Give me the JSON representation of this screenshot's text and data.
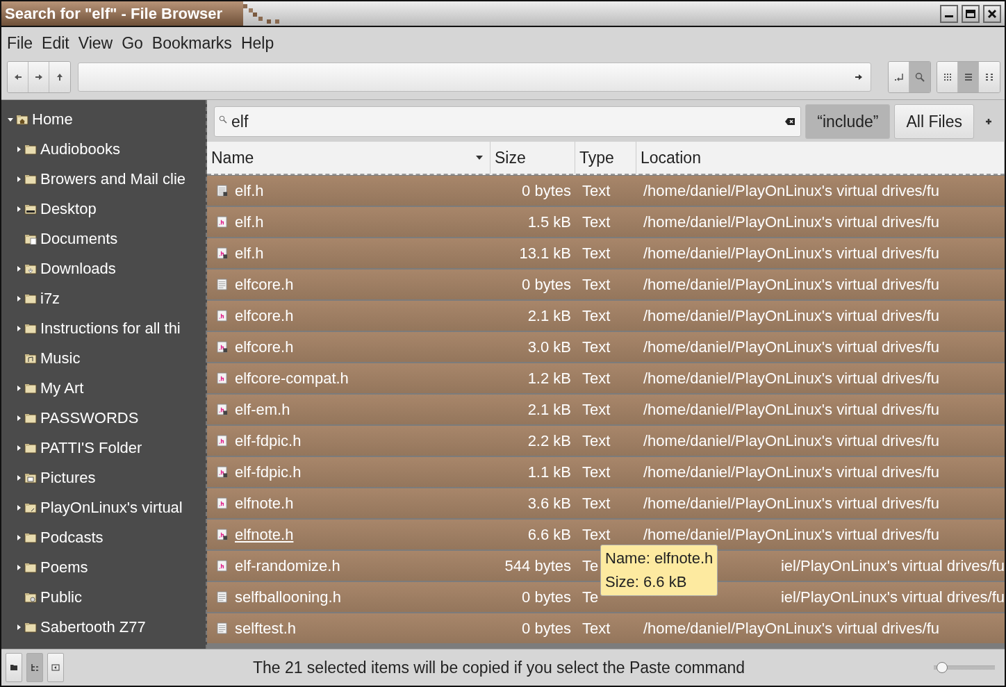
{
  "window": {
    "title": "Search for \"elf\" - File Browser"
  },
  "menu": [
    "File",
    "Edit",
    "View",
    "Go",
    "Bookmarks",
    "Help"
  ],
  "toolbar": {
    "nav": [
      {
        "kind": "back"
      },
      {
        "kind": "forward"
      },
      {
        "kind": "up"
      }
    ],
    "mode_toggles": [
      {
        "kind": "pathbar",
        "selected": false
      },
      {
        "kind": "search",
        "selected": true
      }
    ],
    "view_toggles": [
      {
        "kind": "icons",
        "selected": false
      },
      {
        "kind": "list",
        "selected": true
      },
      {
        "kind": "compact",
        "selected": false
      }
    ]
  },
  "sidebar": {
    "tree": [
      {
        "label": "Home",
        "kind": "home",
        "expandable": true,
        "expanded": true,
        "children": [
          {
            "label": "Audiobooks",
            "kind": "folder",
            "expandable": true,
            "expanded": false
          },
          {
            "label": "Browers and Mail clie",
            "kind": "folder",
            "expandable": true,
            "expanded": false
          },
          {
            "label": "Desktop",
            "kind": "desktop",
            "expandable": true,
            "expanded": false
          },
          {
            "label": "Documents",
            "kind": "documents",
            "expandable": false
          },
          {
            "label": "Downloads",
            "kind": "downloads",
            "expandable": true,
            "expanded": false
          },
          {
            "label": "i7z",
            "kind": "folder",
            "expandable": true,
            "expanded": false
          },
          {
            "label": "Instructions for all thi",
            "kind": "folder",
            "expandable": true,
            "expanded": false
          },
          {
            "label": "Music",
            "kind": "music",
            "expandable": false
          },
          {
            "label": "My Art",
            "kind": "folder",
            "expandable": true,
            "expanded": false
          },
          {
            "label": "PASSWORDS",
            "kind": "folder",
            "expandable": true,
            "expanded": false
          },
          {
            "label": "PATTI'S Folder",
            "kind": "folder",
            "expandable": true,
            "expanded": false
          },
          {
            "label": "Pictures",
            "kind": "pictures",
            "expandable": true,
            "expanded": false
          },
          {
            "label": "PlayOnLinux's virtual",
            "kind": "linked",
            "expandable": true,
            "expanded": false
          },
          {
            "label": "Podcasts",
            "kind": "folder",
            "expandable": true,
            "expanded": false
          },
          {
            "label": "Poems",
            "kind": "folder",
            "expandable": true,
            "expanded": false
          },
          {
            "label": "Public",
            "kind": "public",
            "expandable": false
          },
          {
            "label": "Sabertooth Z77",
            "kind": "folder",
            "expandable": true,
            "expanded": false
          }
        ]
      }
    ]
  },
  "search": {
    "value": "elf",
    "filters": [
      {
        "label": "“include”",
        "selected": true
      },
      {
        "label": "All Files",
        "selected": false
      }
    ]
  },
  "table": {
    "columns": [
      {
        "label": "Name",
        "sorted": true
      },
      {
        "label": "Size",
        "sorted": false
      },
      {
        "label": "Type",
        "sorted": false
      },
      {
        "label": "Location",
        "sorted": false
      }
    ],
    "rows": [
      {
        "kind": "text-locked",
        "name": "elf.h",
        "size": "0 bytes",
        "type": "Text",
        "location": "/home/daniel/PlayOnLinux's virtual drives/fu",
        "selected": true,
        "hovered": false,
        "covered": false
      },
      {
        "kind": "header",
        "name": "elf.h",
        "size": "1.5 kB",
        "type": "Text",
        "location": "/home/daniel/PlayOnLinux's virtual drives/fu",
        "selected": true,
        "hovered": false,
        "covered": false
      },
      {
        "kind": "header-locked",
        "name": "elf.h",
        "size": "13.1 kB",
        "type": "Text",
        "location": "/home/daniel/PlayOnLinux's virtual drives/fu",
        "selected": true,
        "hovered": false,
        "covered": false
      },
      {
        "kind": "text",
        "name": "elfcore.h",
        "size": "0 bytes",
        "type": "Text",
        "location": "/home/daniel/PlayOnLinux's virtual drives/fu",
        "selected": true,
        "hovered": false,
        "covered": false
      },
      {
        "kind": "header",
        "name": "elfcore.h",
        "size": "2.1 kB",
        "type": "Text",
        "location": "/home/daniel/PlayOnLinux's virtual drives/fu",
        "selected": true,
        "hovered": false,
        "covered": false
      },
      {
        "kind": "header-locked",
        "name": "elfcore.h",
        "size": "3.0 kB",
        "type": "Text",
        "location": "/home/daniel/PlayOnLinux's virtual drives/fu",
        "selected": true,
        "hovered": false,
        "covered": false
      },
      {
        "kind": "header",
        "name": "elfcore-compat.h",
        "size": "1.2 kB",
        "type": "Text",
        "location": "/home/daniel/PlayOnLinux's virtual drives/fu",
        "selected": true,
        "hovered": false,
        "covered": false
      },
      {
        "kind": "header-locked",
        "name": "elf-em.h",
        "size": "2.1 kB",
        "type": "Text",
        "location": "/home/daniel/PlayOnLinux's virtual drives/fu",
        "selected": true,
        "hovered": false,
        "covered": false
      },
      {
        "kind": "header",
        "name": "elf-fdpic.h",
        "size": "2.2 kB",
        "type": "Text",
        "location": "/home/daniel/PlayOnLinux's virtual drives/fu",
        "selected": true,
        "hovered": false,
        "covered": false
      },
      {
        "kind": "header-locked",
        "name": "elf-fdpic.h",
        "size": "1.1 kB",
        "type": "Text",
        "location": "/home/daniel/PlayOnLinux's virtual drives/fu",
        "selected": true,
        "hovered": false,
        "covered": false
      },
      {
        "kind": "header",
        "name": "elfnote.h",
        "size": "3.6 kB",
        "type": "Text",
        "location": "/home/daniel/PlayOnLinux's virtual drives/fu",
        "selected": true,
        "hovered": false,
        "covered": false
      },
      {
        "kind": "header-locked",
        "name": "elfnote.h",
        "size": "6.6 kB",
        "type": "Text",
        "location": "/home/daniel/PlayOnLinux's virtual drives/fu",
        "selected": true,
        "hovered": true,
        "covered": false
      },
      {
        "kind": "header",
        "name": "elf-randomize.h",
        "size": "544 bytes",
        "type": "Te",
        "location": "iel/PlayOnLinux's virtual drives/fu",
        "selected": true,
        "hovered": false,
        "covered": true
      },
      {
        "kind": "text",
        "name": "selfballooning.h",
        "size": "0 bytes",
        "type": "Te",
        "location": "iel/PlayOnLinux's virtual drives/fu",
        "selected": true,
        "hovered": false,
        "covered": true
      },
      {
        "kind": "text",
        "name": "selftest.h",
        "size": "0 bytes",
        "type": "Text",
        "location": "/home/daniel/PlayOnLinux's virtual drives/fu",
        "selected": true,
        "hovered": false,
        "covered": false
      }
    ]
  },
  "tooltip": {
    "lines": [
      "Name: elfnote.h",
      "Size: 6.6 kB"
    ]
  },
  "status_bar": {
    "buttons": [
      {
        "kind": "places",
        "selected": false
      },
      {
        "kind": "tree",
        "selected": true
      },
      {
        "kind": "hide-sidebar",
        "selected": false
      }
    ],
    "message": "The 21 selected items will be copied if you select the Paste command",
    "zoom": {
      "level": 0.12
    }
  }
}
